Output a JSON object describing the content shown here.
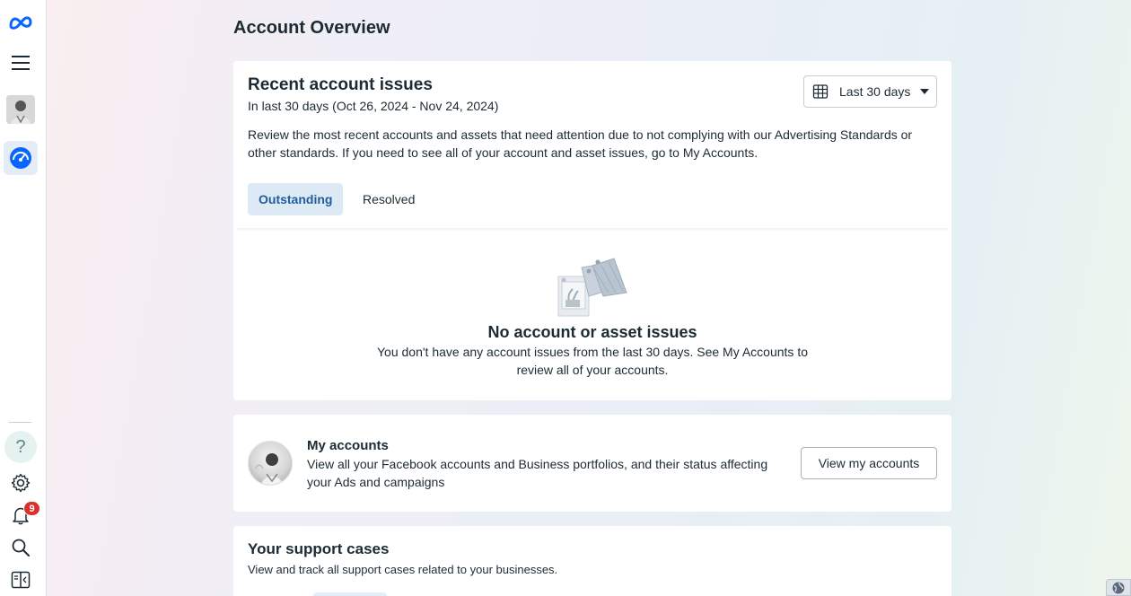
{
  "page": {
    "title": "Account Overview"
  },
  "sidebar": {
    "items": [
      {
        "name": "meta-logo-icon"
      },
      {
        "name": "menu-icon"
      },
      {
        "name": "profile-avatar"
      },
      {
        "name": "account-overview-icon"
      },
      {
        "name": "help-icon",
        "label": "?"
      },
      {
        "name": "settings-icon"
      },
      {
        "name": "notifications-icon",
        "badge": "9"
      },
      {
        "name": "search-icon"
      },
      {
        "name": "panel-toggle-icon"
      }
    ],
    "accent": "#0866ff"
  },
  "issues": {
    "title": "Recent account issues",
    "subtitle": "In last 30 days (Oct 26, 2024 - Nov 24, 2024)",
    "description": "Review the most recent accounts and assets that need attention due to not complying with our Advertising Standards or other standards. If you need to see all of your account and asset issues, go to My Accounts.",
    "date_filter": "Last 30 days",
    "tabs": [
      {
        "label": "Outstanding",
        "active": true
      },
      {
        "label": "Resolved",
        "active": false
      }
    ],
    "empty_title": "No account or asset issues",
    "empty_text": "You don't have any account issues from the last 30 days. See My Accounts to review all of your accounts."
  },
  "accounts": {
    "title": "My accounts",
    "description": "View all your Facebook accounts and Business portfolios, and their status affecting your Ads and campaigns",
    "button": "View my accounts"
  },
  "support": {
    "title": "Your support cases",
    "description": "View and track all support cases related to your businesses."
  },
  "colors": {
    "tab_active_bg": "#ddeaf6",
    "tab_active_text": "#1f5d9a",
    "badge": "#d9302a"
  }
}
